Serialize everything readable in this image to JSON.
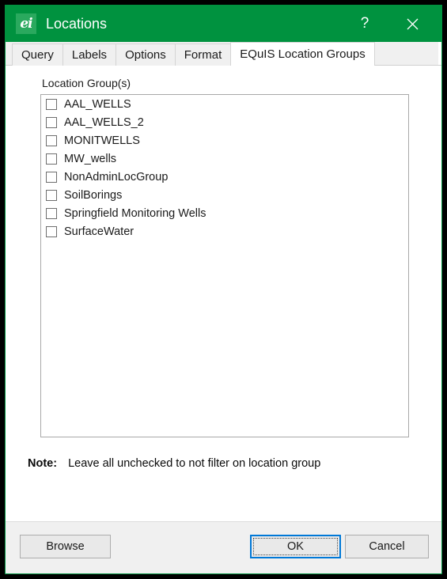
{
  "window": {
    "title": "Locations",
    "app_icon": "equis-ei-icon",
    "help_label": "?",
    "close_label": "✕"
  },
  "tabs": [
    {
      "label": "Query",
      "active": false
    },
    {
      "label": "Labels",
      "active": false
    },
    {
      "label": "Options",
      "active": false
    },
    {
      "label": "Format",
      "active": false
    },
    {
      "label": "EQuIS Location Groups",
      "active": true
    }
  ],
  "main": {
    "group_label": "Location Group(s)",
    "location_groups": [
      {
        "label": "AAL_WELLS",
        "checked": false
      },
      {
        "label": "AAL_WELLS_2",
        "checked": false
      },
      {
        "label": "MONITWELLS",
        "checked": false
      },
      {
        "label": "MW_wells",
        "checked": false
      },
      {
        "label": "NonAdminLocGroup",
        "checked": false
      },
      {
        "label": "SoilBorings",
        "checked": false
      },
      {
        "label": "Springfield Monitoring Wells",
        "checked": false
      },
      {
        "label": "SurfaceWater",
        "checked": false
      }
    ],
    "note_label": "Note:",
    "note_text": "Leave all unchecked to not filter on location group"
  },
  "footer": {
    "browse_label": "Browse",
    "ok_label": "OK",
    "cancel_label": "Cancel"
  },
  "colors": {
    "titlebar_green": "#00923f",
    "icon_green": "#2aa95e",
    "focus_blue": "#0078d7",
    "panel_gray": "#f0f0f0"
  }
}
